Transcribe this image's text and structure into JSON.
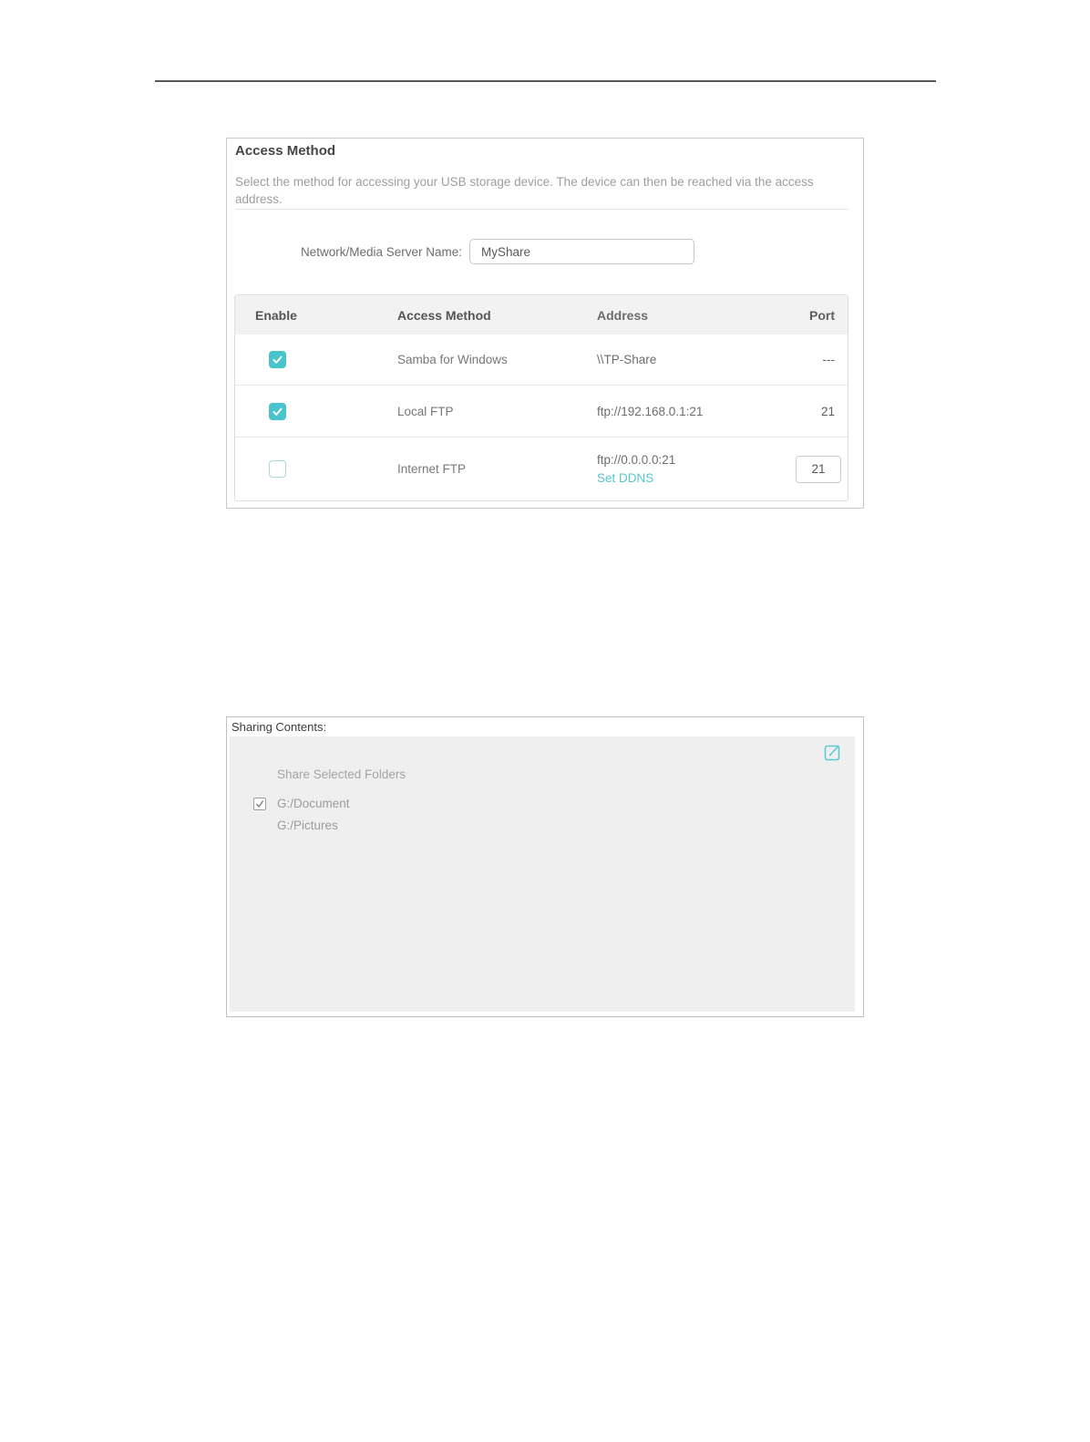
{
  "colors": {
    "accent_teal": "#4ac4cc",
    "link_teal": "#54c6ce",
    "header_bg": "#f2f2f2",
    "gray_area_bg": "#efefef"
  },
  "icons": {
    "checked": "checkmark-icon",
    "edit": "edit-icon"
  },
  "access_method_panel": {
    "title": "Access Method",
    "description": "Select the method for accessing your USB storage device. The device can then be reached via the access address.",
    "server_name": {
      "label": "Network/Media Server Name:",
      "value": "MyShare"
    },
    "table": {
      "headers": [
        "Enable",
        "Access Method",
        "Address",
        "Port"
      ],
      "rows": [
        {
          "enabled": true,
          "method": "Samba for Windows",
          "address": "\\\\TP-Share",
          "port": "---"
        },
        {
          "enabled": true,
          "method": "Local FTP",
          "address": "ftp://192.168.0.1:21",
          "port": "21"
        },
        {
          "enabled": false,
          "method": "Internet FTP",
          "address": "ftp://0.0.0.0:21",
          "address_link": "Set DDNS",
          "port_value": "21"
        }
      ]
    }
  },
  "sharing_contents_panel": {
    "label": "Sharing Contents:",
    "share_mode": "Share Selected Folders",
    "folders": [
      {
        "checked": true,
        "name": "G:/Document"
      },
      {
        "checked": false,
        "name": "G:/Pictures"
      }
    ]
  }
}
